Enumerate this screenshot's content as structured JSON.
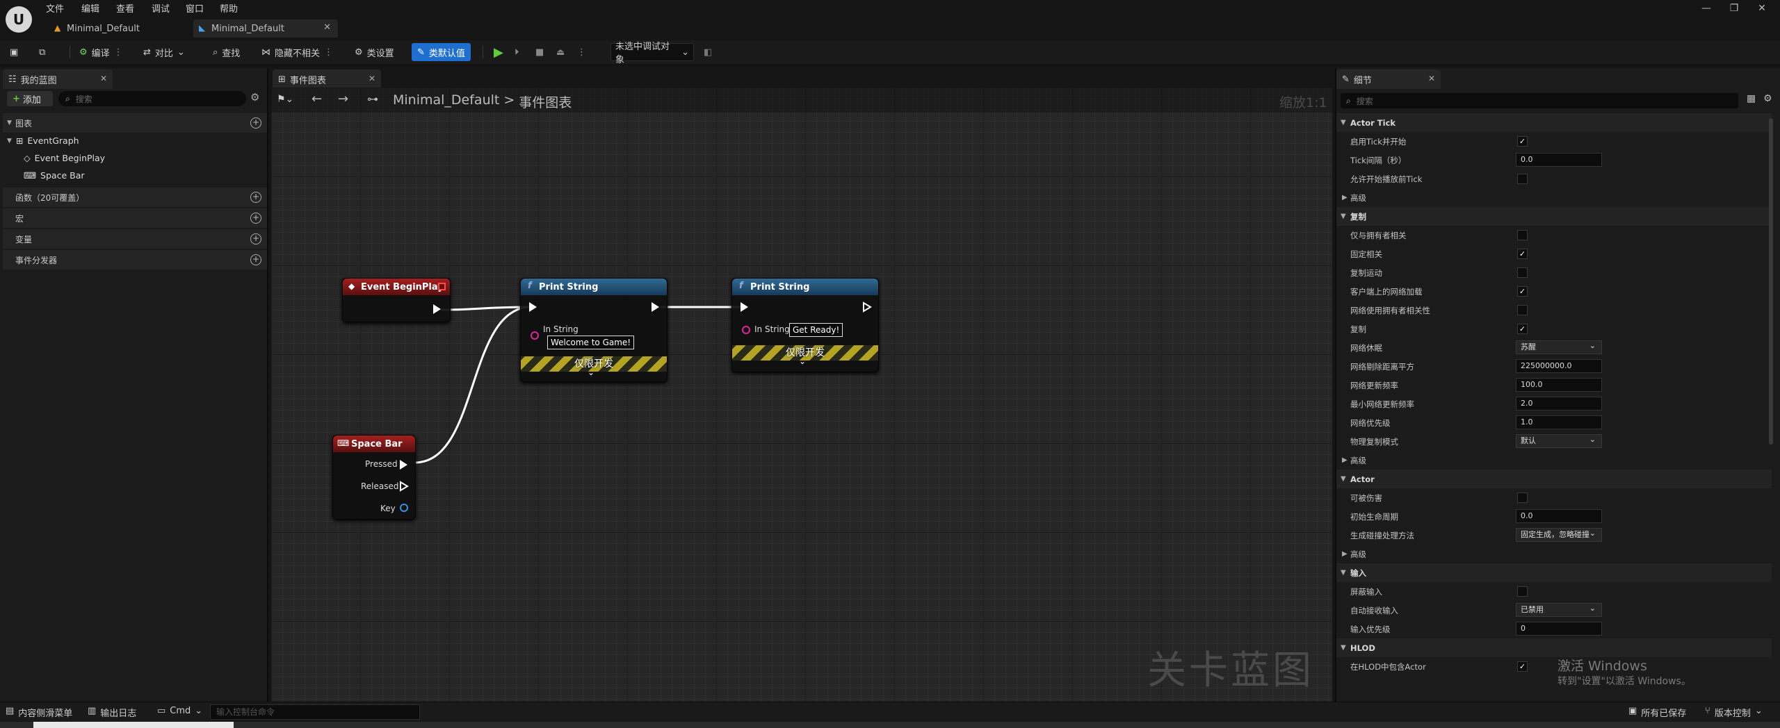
{
  "menu": [
    "文件",
    "编辑",
    "查看",
    "调试",
    "窗口",
    "帮助"
  ],
  "tabs": [
    {
      "label": "Minimal_Default",
      "active": false
    },
    {
      "label": "Minimal_Default",
      "active": true
    }
  ],
  "toolbar": {
    "compile": "编译",
    "diff": "对比",
    "find": "查找",
    "hide_unrelated": "隐藏不相关",
    "class_settings": "类设置",
    "class_defaults": "类默认值",
    "debug_object": "未选中调试对象"
  },
  "left_panel": {
    "tab": "我的蓝图",
    "add_button": "添加",
    "search_placeholder": "搜索",
    "sections": {
      "graphs": "图表",
      "functions": "函数（20可覆盖）",
      "macros": "宏",
      "variables": "变量",
      "dispatchers": "事件分发器"
    },
    "graph_tree": {
      "root": "EventGraph",
      "items": [
        "Event BeginPlay",
        "Space Bar"
      ]
    }
  },
  "graph_panel": {
    "tab": "事件图表",
    "breadcrumb_root": "Minimal_Default",
    "breadcrumb_sep": ">",
    "breadcrumb_current": "事件图表",
    "zoom": "缩放1:1",
    "watermark": "关卡蓝图"
  },
  "nodes": {
    "begin_play": {
      "title": "Event BeginPlay"
    },
    "print1": {
      "title": "Print String",
      "in_label": "In String",
      "in_value": "Welcome to Game!",
      "dev_only": "仅限开发"
    },
    "print2": {
      "title": "Print String",
      "in_label": "In String",
      "in_value": "Get Ready!",
      "dev_only": "仅限开发"
    },
    "space_bar": {
      "title": "Space Bar",
      "pins": [
        "Pressed",
        "Released",
        "Key"
      ]
    }
  },
  "details_panel": {
    "tab": "细节",
    "search_placeholder": "搜索",
    "rows": [
      {
        "type": "cat",
        "label": "Actor Tick"
      },
      {
        "type": "check",
        "label": "启用Tick并开始",
        "checked": true
      },
      {
        "type": "text",
        "label": "Tick间隔（秒）",
        "value": "0.0"
      },
      {
        "type": "check",
        "label": "允许开始播放前Tick",
        "checked": false
      },
      {
        "type": "sub",
        "label": "高级"
      },
      {
        "type": "cat",
        "label": "复制"
      },
      {
        "type": "check",
        "label": "仅与拥有者相关",
        "checked": false
      },
      {
        "type": "check",
        "label": "固定相关",
        "checked": true
      },
      {
        "type": "check",
        "label": "复制运动",
        "checked": false
      },
      {
        "type": "check",
        "label": "客户端上的网络加载",
        "checked": true
      },
      {
        "type": "check",
        "label": "网络使用拥有者相关性",
        "checked": false
      },
      {
        "type": "check",
        "label": "复制",
        "checked": true
      },
      {
        "type": "select",
        "label": "网络休眠",
        "value": "苏醒"
      },
      {
        "type": "text",
        "label": "网络剔除距离平方",
        "value": "225000000.0"
      },
      {
        "type": "text",
        "label": "网络更新频率",
        "value": "100.0"
      },
      {
        "type": "text",
        "label": "最小网络更新频率",
        "value": "2.0"
      },
      {
        "type": "text",
        "label": "网络优先级",
        "value": "1.0"
      },
      {
        "type": "select",
        "label": "物理复制模式",
        "value": "默认"
      },
      {
        "type": "sub",
        "label": "高级"
      },
      {
        "type": "cat",
        "label": "Actor"
      },
      {
        "type": "check",
        "label": "可被伤害",
        "checked": false
      },
      {
        "type": "text",
        "label": "初始生命周期",
        "value": "0.0"
      },
      {
        "type": "select",
        "label": "生成碰撞处理方法",
        "value": "固定生成，忽略碰撞"
      },
      {
        "type": "sub",
        "label": "高级"
      },
      {
        "type": "cat",
        "label": "输入"
      },
      {
        "type": "check",
        "label": "屏蔽输入",
        "checked": false
      },
      {
        "type": "select",
        "label": "自动接收输入",
        "value": "已禁用"
      },
      {
        "type": "text",
        "label": "输入优先级",
        "value": "0"
      },
      {
        "type": "cat",
        "label": "HLOD"
      },
      {
        "type": "check",
        "label": "在HLOD中包含Actor",
        "checked": true
      }
    ]
  },
  "activate_windows": {
    "title": "激活 Windows",
    "subtitle": "转到\"设置\"以激活 Windows。"
  },
  "status_bar": {
    "content_drawer": "内容侧滑菜单",
    "output_log": "输出日志",
    "cmd": "Cmd",
    "cmd_placeholder": "输入控制台命令",
    "saved": "所有已保存",
    "source_control": "版本控制"
  }
}
